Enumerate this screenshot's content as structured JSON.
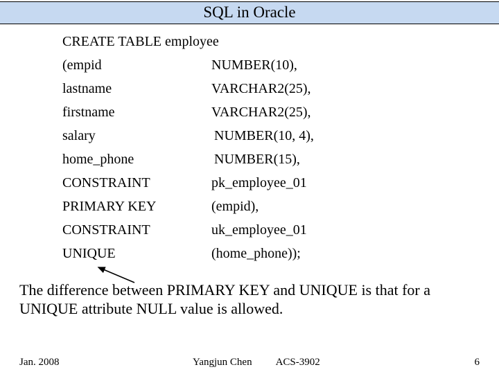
{
  "title": "SQL in Oracle",
  "ddl_statement": "CREATE TABLE employee",
  "rows": [
    {
      "left": "(empid",
      "right": "NUMBER(10),",
      "rpad": ""
    },
    {
      "left": "lastname",
      "right": "VARCHAR2(25),",
      "rpad": ""
    },
    {
      "left": "firstname",
      "right": "VARCHAR2(25),",
      "rpad": ""
    },
    {
      "left": "salary",
      "right": "NUMBER(10, 4),",
      "rpad": "pad4"
    },
    {
      "left": "home_phone",
      "right": "NUMBER(15),",
      "rpad": "pad4"
    },
    {
      "left": "CONSTRAINT",
      "right": "pk_employee_01",
      "rpad": ""
    },
    {
      "left": "PRIMARY KEY",
      "right": "(empid),",
      "rpad": ""
    },
    {
      "left": "CONSTRAINT",
      "right": "uk_employee_01",
      "rpad": ""
    },
    {
      "left": "UNIQUE",
      "right": "(home_phone));",
      "rpad": ""
    }
  ],
  "explain_text": "The difference between PRIMARY KEY and UNIQUE is that for a UNIQUE attribute NULL value is allowed.",
  "footer": {
    "date": "Jan. 2008",
    "author": "Yangjun Chen",
    "course": "ACS-3902",
    "page": "6"
  }
}
